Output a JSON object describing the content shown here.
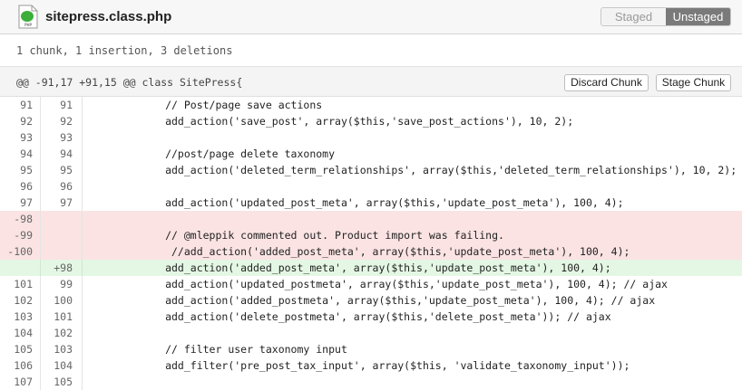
{
  "header": {
    "file_name": "sitepress.class.php",
    "icon": "php-file-icon",
    "segments": [
      {
        "label": "Staged",
        "active": false
      },
      {
        "label": "Unstaged",
        "active": true
      }
    ]
  },
  "summary": "1 chunk, 1 insertion, 3 deletions",
  "hunk": {
    "header": "@@ -91,17 +91,15 @@ class SitePress{",
    "discard_label": "Discard Chunk",
    "stage_label": "Stage Chunk"
  },
  "lines": [
    {
      "old": "91",
      "new": "91",
      "type": "context",
      "code": "            // Post/page save actions"
    },
    {
      "old": "92",
      "new": "92",
      "type": "context",
      "code": "            add_action('save_post', array($this,'save_post_actions'), 10, 2);"
    },
    {
      "old": "93",
      "new": "93",
      "type": "context",
      "code": ""
    },
    {
      "old": "94",
      "new": "94",
      "type": "context",
      "code": "            //post/page delete taxonomy"
    },
    {
      "old": "95",
      "new": "95",
      "type": "context",
      "code": "            add_action('deleted_term_relationships', array($this,'deleted_term_relationships'), 10, 2);"
    },
    {
      "old": "96",
      "new": "96",
      "type": "context",
      "code": ""
    },
    {
      "old": "97",
      "new": "97",
      "type": "context",
      "code": "            add_action('updated_post_meta', array($this,'update_post_meta'), 100, 4);"
    },
    {
      "old": "-98",
      "new": "",
      "type": "del",
      "code": ""
    },
    {
      "old": "-99",
      "new": "",
      "type": "del",
      "code": "            // @mleppik commented out. Product import was failing."
    },
    {
      "old": "-100",
      "new": "",
      "type": "del",
      "code": "             //add_action('added_post_meta', array($this,'update_post_meta'), 100, 4);"
    },
    {
      "old": "",
      "new": "+98",
      "type": "add",
      "code": "            add_action('added_post_meta', array($this,'update_post_meta'), 100, 4);"
    },
    {
      "old": "101",
      "new": "99",
      "type": "context",
      "code": "            add_action('updated_postmeta', array($this,'update_post_meta'), 100, 4); // ajax"
    },
    {
      "old": "102",
      "new": "100",
      "type": "context",
      "code": "            add_action('added_postmeta', array($this,'update_post_meta'), 100, 4); // ajax"
    },
    {
      "old": "103",
      "new": "101",
      "type": "context",
      "code": "            add_action('delete_postmeta', array($this,'delete_post_meta')); // ajax"
    },
    {
      "old": "104",
      "new": "102",
      "type": "context",
      "code": ""
    },
    {
      "old": "105",
      "new": "103",
      "type": "context",
      "code": "            // filter user taxonomy input"
    },
    {
      "old": "106",
      "new": "104",
      "type": "context",
      "code": "            add_filter('pre_post_tax_input', array($this, 'validate_taxonomy_input'));"
    },
    {
      "old": "107",
      "new": "105",
      "type": "context",
      "code": ""
    }
  ]
}
